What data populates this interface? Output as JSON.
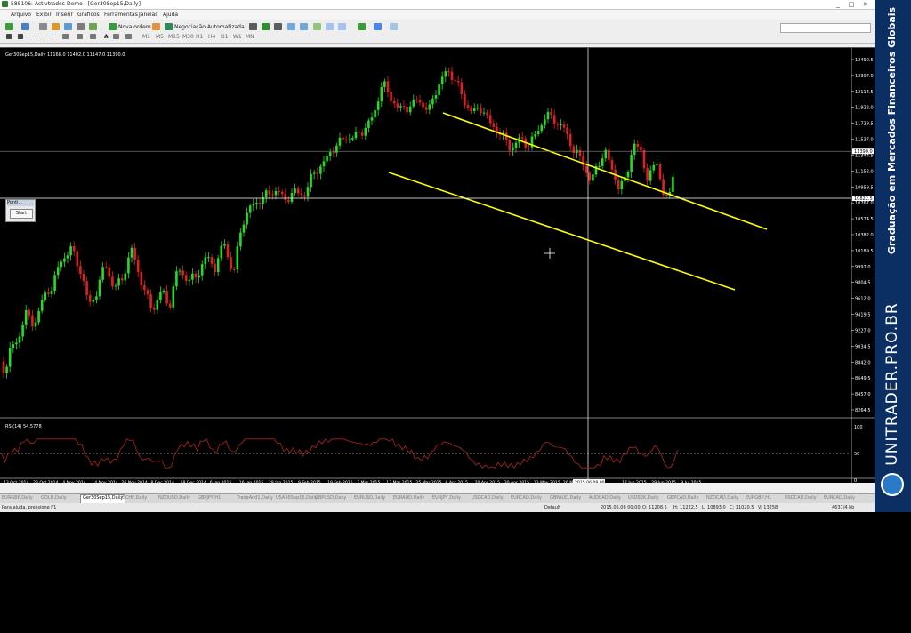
{
  "window": {
    "title": "588106: Activtrades-Demo - [Ger30Sep15,Daily]",
    "controls": [
      "_",
      "□",
      "✕"
    ]
  },
  "menu": [
    "Arquivo",
    "Exibir",
    "Inserir",
    "Gráficos",
    "Ferramentas",
    "Janelas",
    "Ajuda"
  ],
  "toolbar": {
    "new_order_label": "Nova ordem",
    "auto_trading_label": "Negociação Automatizada",
    "timeframes": [
      "M1",
      "M5",
      "M15",
      "M30",
      "H1",
      "H4",
      "D1",
      "W1",
      "MN"
    ]
  },
  "chart": {
    "header": "Ger30Sep15,Daily  11168.0 11402.0 11147.0 11390.0",
    "price_labels": [
      "12499.5",
      "12307.0",
      "12114.5",
      "11922.0",
      "11729.5",
      "11537.0",
      "11344.5",
      "11152.0",
      "10959.5",
      "10767.0",
      "10574.5",
      "10382.0",
      "10189.5",
      "9997.0",
      "9804.5",
      "9612.0",
      "9419.5",
      "9227.0",
      "9034.5",
      "8842.0",
      "8649.5",
      "8457.0",
      "8264.5"
    ],
    "current_price_tag": "11390.0",
    "crosshair_price_tag": "10822.5",
    "crosshair_date_tag": "2015.06.08 00:00",
    "date_labels": [
      "13 Oct 2014",
      "23 Oct 2014",
      "4 Nov 2014",
      "14 Nov 2014",
      "26 Nov 2014",
      "8 Dec 2014",
      "18 Dec 2014",
      "6 Jan 2015",
      "16 Jan 2015",
      "28 Jan 2015",
      "9 Feb 2015",
      "19 Feb 2015",
      "3 Mar 2015",
      "13 Mar 2015",
      "25 Mar 2015",
      "8 Apr 2015",
      "20 Apr 2015",
      "30 Apr 2015",
      "13 May 2015",
      "26 May 2015",
      "",
      "17 Jun 2015",
      "29 Jun 2015",
      "9 Jul 2015"
    ],
    "colors": {
      "bull": "#22dd22",
      "bear": "#e02020",
      "channel": "#ffff00",
      "rsi": "#b22222"
    }
  },
  "rsi": {
    "header": "RSI(14) 54.5778",
    "levels": [
      "100",
      "50",
      "0"
    ]
  },
  "mini_window": {
    "title": "Ponti...",
    "start_label": "Start"
  },
  "tabs": [
    "EURGBP,Daily",
    "GOLD,Daily",
    "Ger30Sep15,Daily",
    "USCHF,Daily",
    "NZDUSD,Daily",
    "GBPJPY,H1",
    "TradeAdd1,Daily",
    "USA30Sep15,Daily",
    "GBPUSD,Daily",
    "EURUSD,Daily",
    "EURAUD,Daily",
    "EURJPY,Daily",
    "USDCAD,Daily",
    "EURCAD,Daily",
    "GBPAUD,Daily",
    "AUDCAD,Daily",
    "USDSEK,Daily",
    "GBPCAD,Daily",
    "NZDCAD,Daily",
    "EURGBP,H1",
    "USDCAD,Daily",
    "EURCAD,Daily"
  ],
  "active_tab_index": 2,
  "status": {
    "help": "Para ajuda, pressione F1",
    "profile": "Default",
    "datetime": "2015.06.08 00:00",
    "open": "O: 11208.5",
    "high": "H: 11222.5",
    "low": "L: 10893.0",
    "close": "C: 11020.5",
    "volume": "V: 13258",
    "traffic": "4637/4 kb"
  },
  "brand": {
    "tagline": "Graduação em Mercados Financeiros Globais",
    "name": "UNITRADER.PRO.BR"
  }
}
